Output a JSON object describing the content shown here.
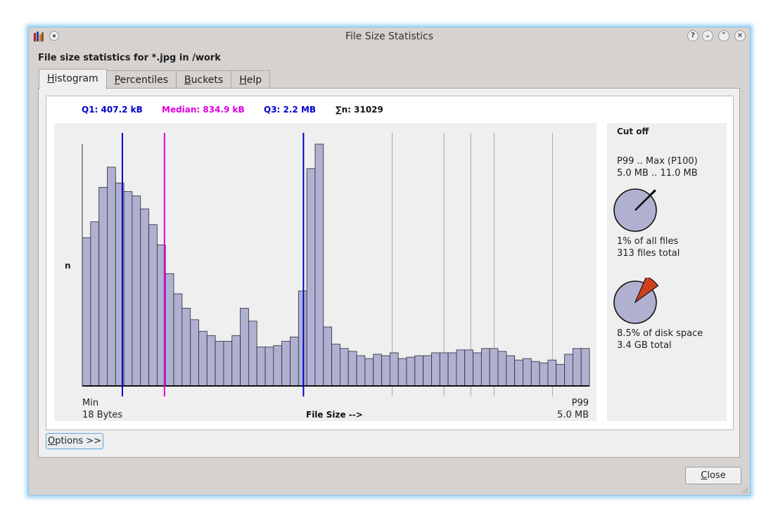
{
  "window": {
    "title": "File Size Statistics",
    "heading": "File size statistics for *.jpg in /work"
  },
  "tabs": [
    {
      "prefix": "",
      "accel": "H",
      "rest": "istogram"
    },
    {
      "prefix": "",
      "accel": "P",
      "rest": "ercentiles"
    },
    {
      "prefix": "",
      "accel": "B",
      "rest": "uckets"
    },
    {
      "prefix": "",
      "accel": "H",
      "rest": "elp"
    }
  ],
  "stats": {
    "q1": "Q1: 407.2 kB",
    "median": "Median: 834.9 kB",
    "q3": "Q3: 2.2 MB",
    "n": "∑n: 31029"
  },
  "colors": {
    "q1": "#0000d0",
    "median": "#e000e0",
    "q3": "#0000d0",
    "bar_fill": "#b0b0d0",
    "cutoff_slice": "#d04020"
  },
  "chart_data": {
    "type": "bar",
    "title": "",
    "xlabel": "File Size  -->",
    "ylabel": "n",
    "x_min_label": "Min",
    "x_min_value": "18 Bytes",
    "x_max_label": "P99",
    "x_max_value": "5.0 MB",
    "percentile_fractions": {
      "q1": 0.079,
      "median": 0.162,
      "q3": 0.436,
      "markers": [
        0.611,
        0.713,
        0.766,
        0.812,
        0.927
      ]
    },
    "values": [
      103,
      114,
      138,
      152,
      141,
      135,
      132,
      123,
      112,
      98,
      78,
      64,
      54,
      46,
      38,
      35,
      31,
      31,
      35,
      54,
      45,
      27,
      27,
      28,
      31,
      34,
      66,
      151,
      168,
      41,
      29,
      26,
      24,
      21,
      19,
      22,
      21,
      23,
      19,
      20,
      21,
      21,
      23,
      23,
      23,
      25,
      25,
      23,
      26,
      26,
      24,
      21,
      18,
      19,
      17,
      16,
      18,
      15,
      22,
      26,
      26
    ]
  },
  "cutoff": {
    "title": "Cut off",
    "range_label": "P99 .. Max (P100)",
    "range_values": "5.0 MB .. 11.0 MB",
    "files_percent": 0.01,
    "files_percent_text": "1% of all files",
    "files_total": "313 files total",
    "disk_percent": 0.085,
    "disk_percent_text": "8.5% of disk space",
    "disk_total": "3.4 GB total"
  },
  "buttons": {
    "options_accel": "O",
    "options_rest": "ptions >>",
    "close_accel": "C",
    "close_rest": "lose"
  }
}
